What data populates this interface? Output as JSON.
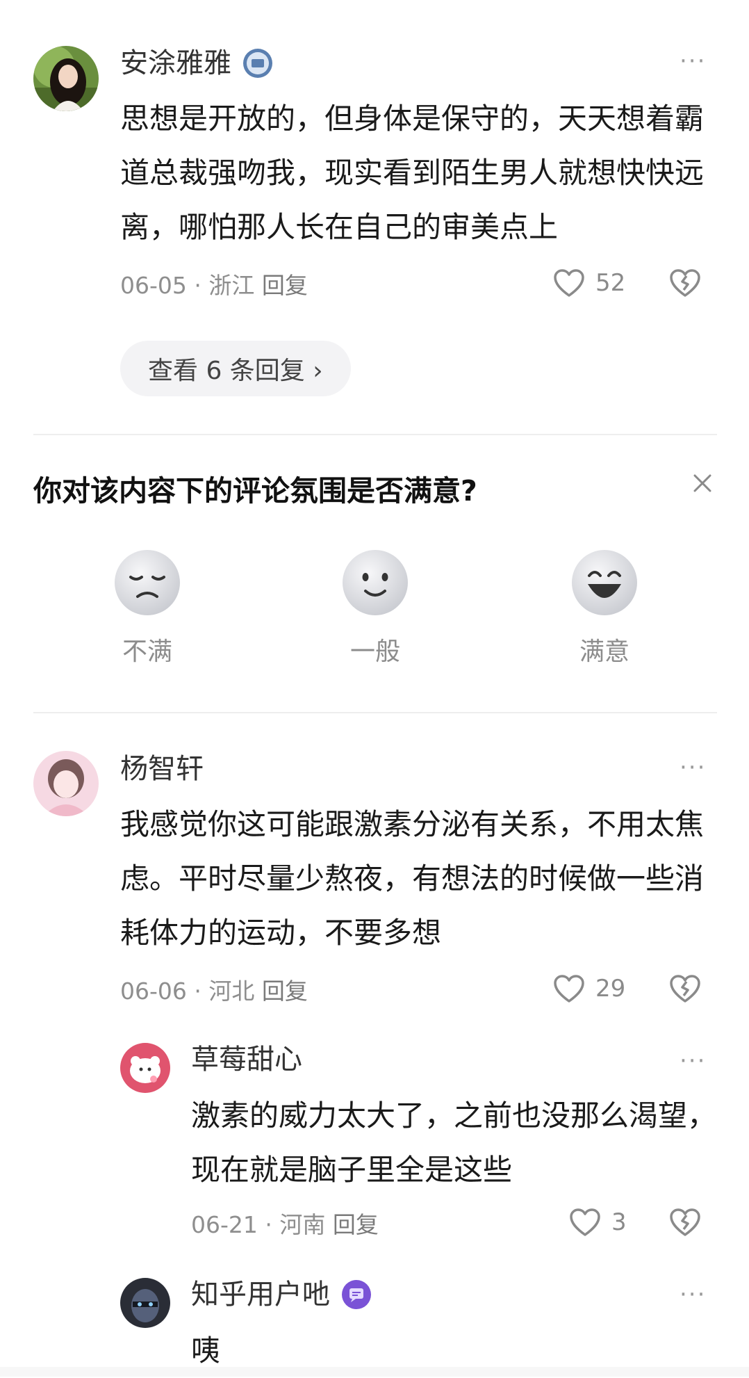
{
  "comments": [
    {
      "username": "安涂雅雅",
      "text": "思想是开放的，但身体是保守的，天天想着霸道总裁强吻我，现实看到陌生男人就想快快远离，哪怕那人长在自己的审美点上",
      "date": "06-05",
      "location": "浙江",
      "reply_label": "回复",
      "likes": "52",
      "view_replies": "查看 6 条回复 ›"
    },
    {
      "username": "杨智轩",
      "text": "我感觉你这可能跟激素分泌有关系，不用太焦虑。平时尽量少熬夜，有想法的时候做一些消耗体力的运动，不要多想",
      "date": "06-06",
      "location": "河北",
      "reply_label": "回复",
      "likes": "29"
    },
    {
      "username": "草莓甜心",
      "text": "激素的威力太大了，之前也没那么渴望，现在就是脑子里全是这些",
      "date": "06-21",
      "location": "河南",
      "reply_label": "回复",
      "likes": "3"
    },
    {
      "username": "知乎用户吔",
      "text": "咦"
    }
  ],
  "survey": {
    "title": "你对该内容下的评论氛围是否满意?",
    "options": [
      {
        "label": "不满",
        "icon": "unhappy-face-icon"
      },
      {
        "label": "一般",
        "icon": "neutral-face-icon"
      },
      {
        "label": "满意",
        "icon": "happy-face-icon"
      }
    ]
  },
  "separator": "·",
  "more_glyph": "···",
  "colors": {
    "text": "#1a1a1a",
    "meta": "#8e8e8e",
    "divider": "#eeeeee",
    "pill_bg": "#f3f3f5"
  }
}
